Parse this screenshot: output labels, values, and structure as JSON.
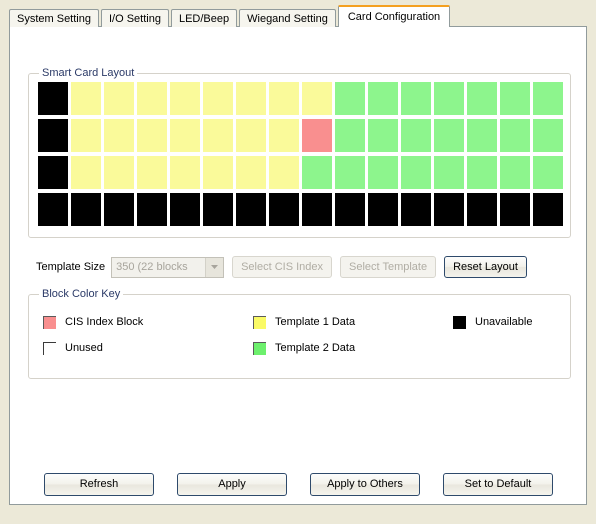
{
  "window": {
    "background_color": "#ECE9D8"
  },
  "tabs": [
    {
      "label": "System Setting",
      "active": false
    },
    {
      "label": "I/O Setting",
      "active": false
    },
    {
      "label": "LED/Beep",
      "active": false
    },
    {
      "label": "Wiegand Setting",
      "active": false
    },
    {
      "label": "Card Configuration",
      "active": true
    }
  ],
  "layout_group": {
    "title": "Smart Card Layout",
    "columns": 16,
    "rows": 4,
    "cells": [
      [
        "unavail",
        "t1",
        "t1",
        "t1",
        "t1",
        "t1",
        "t1",
        "t1",
        "t1",
        "t2",
        "t2",
        "t2",
        "t2",
        "t2",
        "t2",
        "t2"
      ],
      [
        "unavail",
        "t1",
        "t1",
        "t1",
        "t1",
        "t1",
        "t1",
        "t1",
        "cis",
        "t2",
        "t2",
        "t2",
        "t2",
        "t2",
        "t2",
        "t2"
      ],
      [
        "unavail",
        "t1",
        "t1",
        "t1",
        "t1",
        "t1",
        "t1",
        "t1",
        "t2",
        "t2",
        "t2",
        "t2",
        "t2",
        "t2",
        "t2",
        "t2"
      ],
      [
        "unavail",
        "unavail",
        "unavail",
        "unavail",
        "unavail",
        "unavail",
        "unavail",
        "unavail",
        "unavail",
        "unavail",
        "unavail",
        "unavail",
        "unavail",
        "unavail",
        "unavail",
        "unavail"
      ]
    ]
  },
  "template_row": {
    "label": "Template Size",
    "combo_value": "350 (22 blocks",
    "combo_enabled": false,
    "select_cis_index": "Select CIS Index",
    "select_cis_index_enabled": false,
    "select_template": "Select Template",
    "select_template_enabled": false,
    "reset_layout": "Reset Layout",
    "reset_layout_enabled": true
  },
  "key_group": {
    "title": "Block Color Key",
    "items": [
      {
        "label": "CIS Index Block",
        "color": "#F98F8F",
        "swatch": "cis"
      },
      {
        "label": "Template 1 Data",
        "color": "#FAFA66",
        "swatch": "t1"
      },
      {
        "label": "Unavailable",
        "color": "#000000",
        "swatch": "unavail"
      },
      {
        "label": "Unused",
        "color": "#FFFFFF",
        "swatch": "unused"
      },
      {
        "label": "Template 2 Data",
        "color": "#6DF06D",
        "swatch": "t2"
      }
    ]
  },
  "bottom_buttons": [
    {
      "label": "Refresh"
    },
    {
      "label": "Apply"
    },
    {
      "label": "Apply to Others"
    },
    {
      "label": "Set to Default"
    }
  ],
  "colors": {
    "cell_template1": "#FAFA9A",
    "cell_template2": "#8DF58D",
    "cell_cis": "#F98F8F",
    "cell_unavailable": "#000000",
    "active_tab_accent": "#F4A020",
    "group_title_text": "#2B3A67",
    "button_border": "#2E4A6B"
  }
}
